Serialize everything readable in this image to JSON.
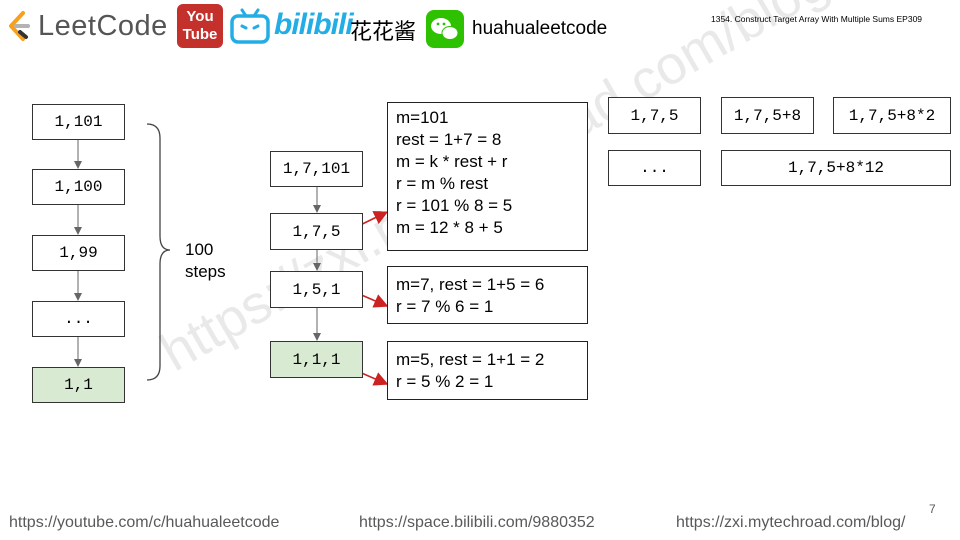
{
  "header": {
    "leetcode_label": "LeetCode",
    "youtube_top": "You",
    "youtube_bottom": "Tube",
    "bilibili_label": "bilibili",
    "channel_cn": "花花酱",
    "wechat_id": "huahualeetcode",
    "episode": "1354. Construct Target Array With Multiple Sums EP309"
  },
  "left_chain": [
    "1,101",
    "1,100",
    "1,99",
    "...",
    "1,1"
  ],
  "brace_label": [
    "100",
    "steps"
  ],
  "middle_chain": [
    "1,7,101",
    "1,7,5",
    "1,5,1",
    "1,1,1"
  ],
  "notes": [
    [
      "m=101",
      "rest = 1+7 = 8",
      "m = k * rest + r",
      "r = m % rest",
      "r = 101 % 8 = 5",
      "m = 12 * 8 + 5"
    ],
    [
      "m=7, rest = 1+5 = 6",
      "r = 7 % 6 = 1"
    ],
    [
      "m=5, rest = 1+1 = 2",
      "r = 5 % 2 = 1"
    ]
  ],
  "right_grid": [
    "1,7,5",
    "1,7,5+8",
    "1,7,5+8*2",
    "...",
    "1,7,5+8*12"
  ],
  "watermark": "https://zxi.mytechroad.com/blog/",
  "page_number": "7",
  "footer": {
    "youtube": "https://youtube.com/c/huahualeetcode",
    "bilibili": "https://space.bilibili.com/9880352",
    "blog": "https://zxi.mytechroad.com/blog/"
  },
  "colors": {
    "accent_arrow": "#cc2222",
    "done_fill": "#d9ead3",
    "youtube_red": "#c4302b",
    "bilibili_blue": "#23ade5",
    "wechat_green": "#2dc100"
  }
}
